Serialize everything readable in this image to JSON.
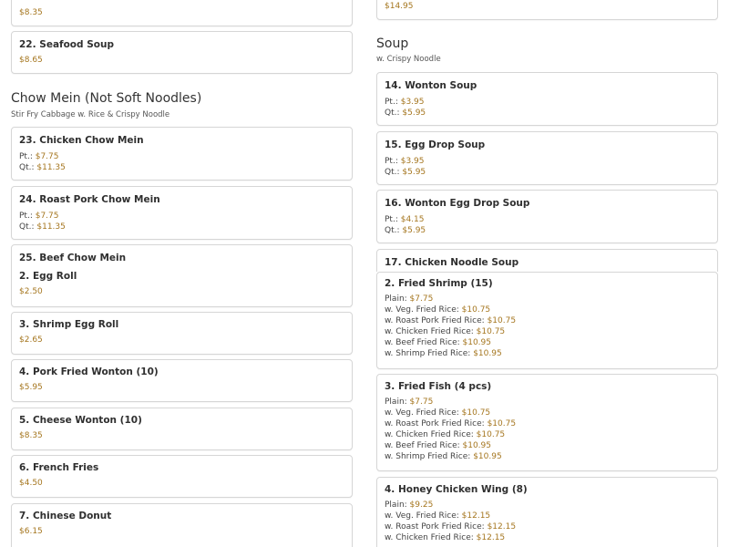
{
  "top": {
    "left": {
      "item_partial": {
        "price": "$8.35"
      },
      "item_seafood_soup": {
        "title": "22. Seafood Soup",
        "price": "$8.65"
      },
      "section": {
        "title": "Chow Mein (Not Soft Noodles)",
        "subtitle": "Stir Fry Cabbage w. Rice & Crispy Noodle"
      },
      "items": [
        {
          "title": "23. Chicken Chow Mein",
          "pt_label": "Pt.: ",
          "pt": "$7.75",
          "qt_label": "Qt.: ",
          "qt": "$11.35"
        },
        {
          "title": "24. Roast Pork Chow Mein",
          "pt_label": "Pt.: ",
          "pt": "$7.75",
          "qt_label": "Qt.: ",
          "qt": "$11.35"
        },
        {
          "title": "25. Beef Chow Mein"
        }
      ]
    },
    "right": {
      "item_partial": {
        "price": "$14.95"
      },
      "section": {
        "title": "Soup",
        "subtitle": "w. Crispy Noodle"
      },
      "items": [
        {
          "title": "14. Wonton Soup",
          "pt_label": "Pt.: ",
          "pt": "$3.95",
          "qt_label": "Qt.: ",
          "qt": "$5.95"
        },
        {
          "title": "15. Egg Drop Soup",
          "pt_label": "Pt.: ",
          "pt": "$3.95",
          "qt_label": "Qt.: ",
          "qt": "$5.95"
        },
        {
          "title": "16. Wonton Egg Drop Soup",
          "pt_label": "Pt.: ",
          "pt": "$4.15",
          "qt_label": "Qt.: ",
          "qt": "$5.95"
        },
        {
          "title": "17. Chicken Noodle Soup"
        }
      ]
    }
  },
  "bottom": {
    "left": {
      "items": [
        {
          "title": "2. Egg Roll",
          "price": "$2.50"
        },
        {
          "title": "3. Shrimp Egg Roll",
          "price": "$2.65"
        },
        {
          "title": "4. Pork Fried Wonton (10)",
          "price": "$5.95"
        },
        {
          "title": "5. Cheese Wonton (10)",
          "price": "$8.35"
        },
        {
          "title": "6. French Fries",
          "price": "$4.50"
        },
        {
          "title": "7. Chinese Donut",
          "price": "$6.15"
        }
      ]
    },
    "right": {
      "items": [
        {
          "title": "2. Fried Shrimp (15)",
          "lines": [
            {
              "label": "Plain: ",
              "price": "$7.75"
            },
            {
              "label": "w. Veg. Fried Rice: ",
              "price": "$10.75"
            },
            {
              "label": "w. Roast Pork Fried Rice: ",
              "price": "$10.75"
            },
            {
              "label": "w. Chicken Fried Rice: ",
              "price": "$10.75"
            },
            {
              "label": "w. Beef Fried Rice: ",
              "price": "$10.95"
            },
            {
              "label": "w. Shrimp Fried Rice: ",
              "price": "$10.95"
            }
          ]
        },
        {
          "title": "3. Fried Fish (4 pcs)",
          "lines": [
            {
              "label": "Plain: ",
              "price": "$7.75"
            },
            {
              "label": "w. Veg. Fried Rice: ",
              "price": "$10.75"
            },
            {
              "label": "w. Roast Pork Fried Rice: ",
              "price": "$10.75"
            },
            {
              "label": "w. Chicken Fried Rice: ",
              "price": "$10.75"
            },
            {
              "label": "w. Beef Fried Rice: ",
              "price": "$10.95"
            },
            {
              "label": "w. Shrimp Fried Rice: ",
              "price": "$10.95"
            }
          ]
        },
        {
          "title": "4. Honey Chicken Wing (8)",
          "lines": [
            {
              "label": "Plain: ",
              "price": "$9.25"
            },
            {
              "label": "w. Veg. Fried Rice: ",
              "price": "$12.15"
            },
            {
              "label": "w. Roast Pork Fried Rice: ",
              "price": "$12.15"
            },
            {
              "label": "w. Chicken Fried Rice: ",
              "price": "$12.15"
            }
          ]
        }
      ]
    }
  }
}
